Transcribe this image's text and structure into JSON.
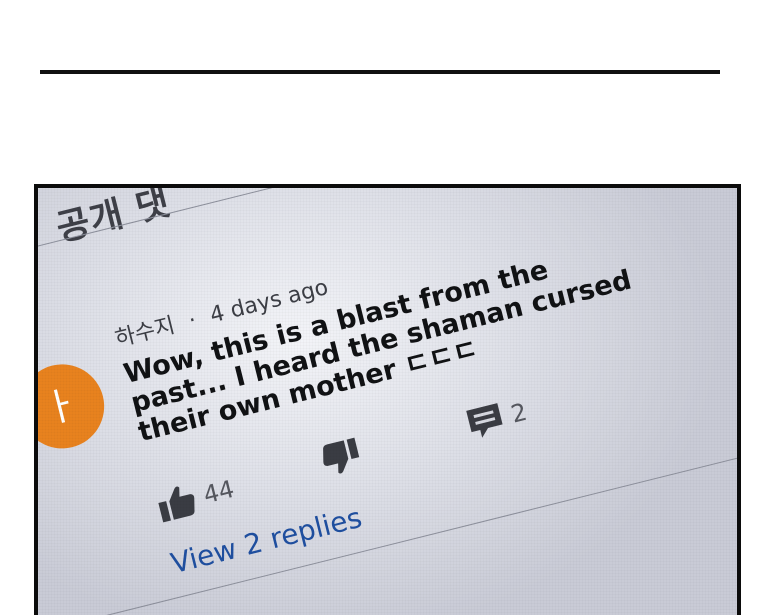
{
  "page": {
    "header_partial": "공개 댓"
  },
  "comment": {
    "author": "하수지",
    "separator": "·",
    "time": "4 days ago",
    "text": "Wow, this is a blast from the past... I heard the shaman cursed their own mother ㄷㄷㄷ",
    "likes": "44",
    "reply_count": "2",
    "view_replies_label": "View 2 replies",
    "avatar_letter": "ㅏ"
  },
  "icons": {
    "like": "thumbs-up-icon",
    "dislike": "thumbs-down-icon",
    "reply": "comment-icon"
  },
  "colors": {
    "avatar": "#e8821e",
    "link": "#1f4fa0",
    "accent_edge": "#b8457a"
  }
}
